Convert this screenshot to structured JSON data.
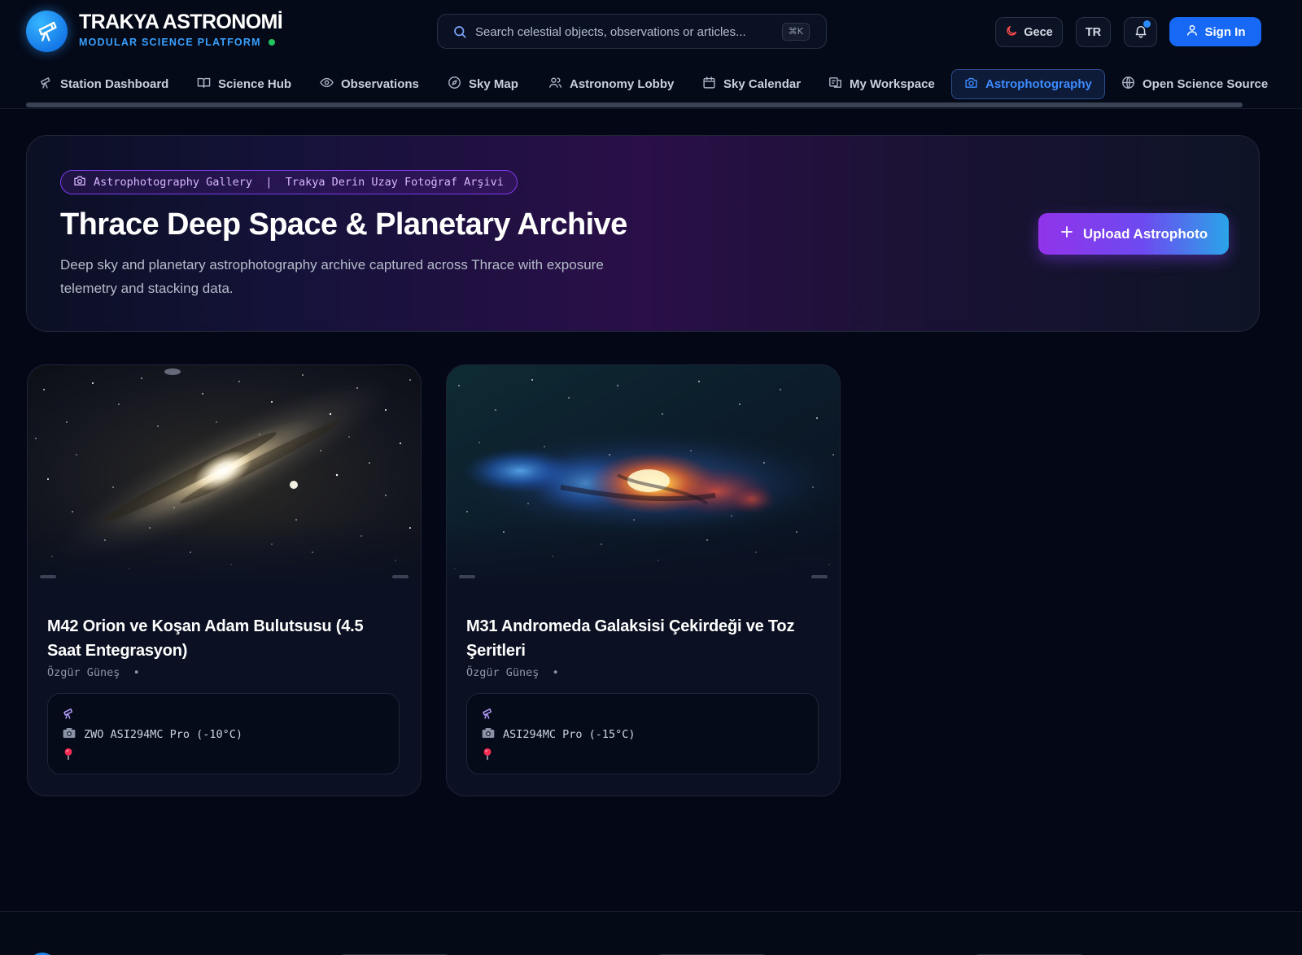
{
  "brand": {
    "title": "TRAKYA ASTRONOMİ",
    "subtitle": "MODULAR SCIENCE PLATFORM",
    "accent_color": "#1b86f0",
    "status_color": "#22c55e"
  },
  "search": {
    "placeholder": "Search celestial objects, observations or articles...",
    "shortcut": "⌘K"
  },
  "header_actions": {
    "theme_label": "Gece",
    "language_label": "TR",
    "sign_in_label": "Sign In",
    "sign_in_color": "#1768f5"
  },
  "nav": {
    "items": [
      {
        "label": "Station Dashboard",
        "icon": "telescope-icon"
      },
      {
        "label": "Science Hub",
        "icon": "book-open-icon"
      },
      {
        "label": "Observations",
        "icon": "eye-icon"
      },
      {
        "label": "Sky Map",
        "icon": "compass-icon"
      },
      {
        "label": "Astronomy Lobby",
        "icon": "users-icon"
      },
      {
        "label": "Sky Calendar",
        "icon": "calendar-icon"
      },
      {
        "label": "My Workspace",
        "icon": "workspace-icon"
      },
      {
        "label": "Astrophotography",
        "icon": "camera-icon",
        "active": true
      },
      {
        "label": "Open Science Source",
        "icon": "globe-icon"
      }
    ]
  },
  "hero": {
    "tag": "Astrophotography Gallery  |  Trakya Derin Uzay Fotoğraf Arşivi",
    "title": "Thrace Deep Space & Planetary Archive",
    "description": "Deep sky and planetary astrophotography archive captured across Thrace with exposure telemetry and stacking data.",
    "upload_label": "Upload Astrophoto"
  },
  "cards": [
    {
      "title": "M42 Orion ve Koşan Adam Bulutsusu (4.5 Saat Entegrasyon)",
      "author": "Özgür Güneş  •",
      "camera": "ZWO ASI294MC Pro (-10°C)",
      "image_icon": "galaxy-photo"
    },
    {
      "title": "M31 Andromeda Galaksisi Çekirdeği ve Toz Şeritleri",
      "author": "Özgür Güneş  •",
      "camera": "ASI294MC Pro (-15°C)",
      "image_icon": "milky-way-photo"
    }
  ]
}
